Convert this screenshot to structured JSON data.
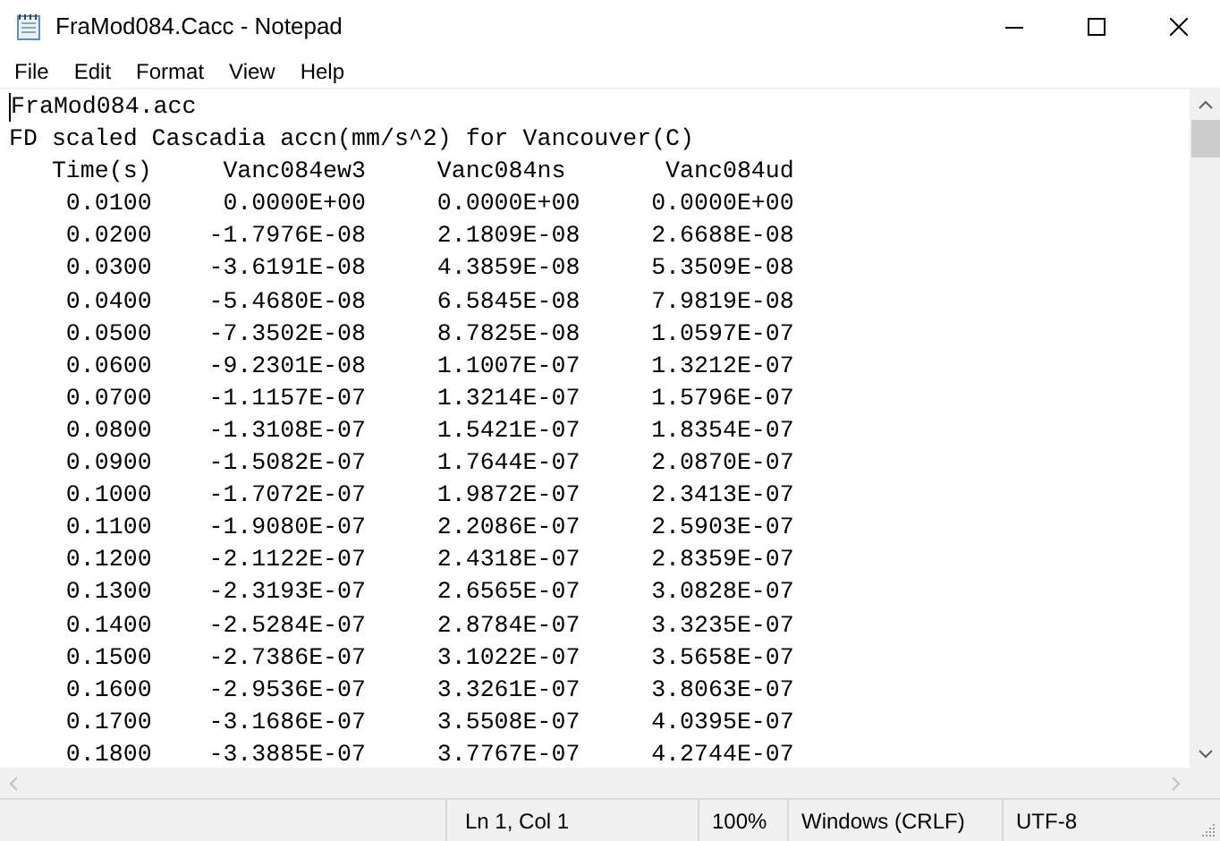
{
  "window": {
    "title": "FraMod084.Cacc - Notepad"
  },
  "menu": [
    "File",
    "Edit",
    "Format",
    "View",
    "Help"
  ],
  "lines": [
    "FraMod084.acc",
    "FD scaled Cascadia accn(mm/s^2) for Vancouver(C)",
    "   Time(s)     Vanc084ew3     Vanc084ns       Vanc084ud",
    "    0.0100     0.0000E+00     0.0000E+00     0.0000E+00",
    "    0.0200    -1.7976E-08     2.1809E-08     2.6688E-08",
    "    0.0300    -3.6191E-08     4.3859E-08     5.3509E-08",
    "    0.0400    -5.4680E-08     6.5845E-08     7.9819E-08",
    "    0.0500    -7.3502E-08     8.7825E-08     1.0597E-07",
    "    0.0600    -9.2301E-08     1.1007E-07     1.3212E-07",
    "    0.0700    -1.1157E-07     1.3214E-07     1.5796E-07",
    "    0.0800    -1.3108E-07     1.5421E-07     1.8354E-07",
    "    0.0900    -1.5082E-07     1.7644E-07     2.0870E-07",
    "    0.1000    -1.7072E-07     1.9872E-07     2.3413E-07",
    "    0.1100    -1.9080E-07     2.2086E-07     2.5903E-07",
    "    0.1200    -2.1122E-07     2.4318E-07     2.8359E-07",
    "    0.1300    -2.3193E-07     2.6565E-07     3.0828E-07",
    "    0.1400    -2.5284E-07     2.8784E-07     3.3235E-07",
    "    0.1500    -2.7386E-07     3.1022E-07     3.5658E-07",
    "    0.1600    -2.9536E-07     3.3261E-07     3.8063E-07",
    "    0.1700    -3.1686E-07     3.5508E-07     4.0395E-07",
    "    0.1800    -3.3885E-07     3.7767E-07     4.2744E-07"
  ],
  "status_bar": {
    "position": "Ln 1, Col 1",
    "zoom": "100%",
    "line_endings": "Windows (CRLF)",
    "encoding": "UTF-8"
  }
}
